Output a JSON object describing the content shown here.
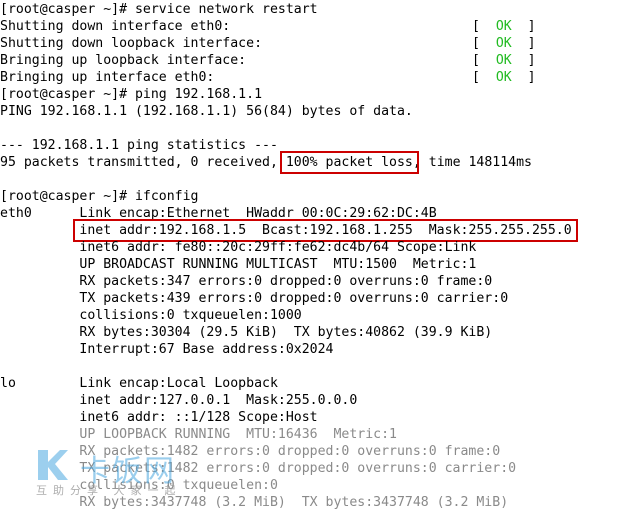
{
  "terminal": {
    "lines": [
      {
        "text": "[root@casper ~]# service network restart"
      },
      {
        "text": "Shutting down interface eth0:",
        "status": "OK"
      },
      {
        "text": "Shutting down loopback interface:",
        "status": "OK"
      },
      {
        "text": "Bringing up loopback interface:",
        "status": "OK"
      },
      {
        "text": "Bringing up interface eth0:",
        "status": "OK"
      },
      {
        "text": "[root@casper ~]# ping 192.168.1.1"
      },
      {
        "text": "PING 192.168.1.1 (192.168.1.1) 56(84) bytes of data."
      },
      {
        "text": ""
      },
      {
        "text": "--- 192.168.1.1 ping statistics ---"
      },
      {
        "pre": "95 packets transmitted, 0 received, ",
        "highlight": "100% packet loss",
        "post": ", time 148114ms"
      },
      {
        "text": ""
      },
      {
        "text": "[root@casper ~]# ifconfig"
      },
      {
        "text": "eth0      Link encap:Ethernet  HWaddr 00:0C:29:62:DC:4B"
      },
      {
        "pre": "          ",
        "highlight": "inet addr:192.168.1.5  Bcast:192.168.1.255  Mask:255.255.255.0",
        "post": ""
      },
      {
        "text": "          inet6 addr: fe80::20c:29ff:fe62:dc4b/64 Scope:Link"
      },
      {
        "text": "          UP BROADCAST RUNNING MULTICAST  MTU:1500  Metric:1"
      },
      {
        "text": "          RX packets:347 errors:0 dropped:0 overruns:0 frame:0"
      },
      {
        "text": "          TX packets:439 errors:0 dropped:0 overruns:0 carrier:0"
      },
      {
        "text": "          collisions:0 txqueuelen:1000"
      },
      {
        "text": "          RX bytes:30304 (29.5 KiB)  TX bytes:40862 (39.9 KiB)"
      },
      {
        "text": "          Interrupt:67 Base address:0x2024"
      },
      {
        "text": ""
      },
      {
        "text": "lo        Link encap:Local Loopback"
      },
      {
        "text": "          inet addr:127.0.0.1  Mask:255.0.0.0"
      },
      {
        "text": "          inet6 addr: ::1/128 Scope:Host"
      },
      {
        "text": "          UP LOOPBACK RUNNING  MTU:16436  Metric:1"
      },
      {
        "text": "          RX packets:1482 errors:0 dropped:0 overruns:0 frame:0"
      },
      {
        "text": "          TX packets:1482 errors:0 dropped:0 overruns:0 carrier:0"
      },
      {
        "text": "          collisions:0 txqueuelen:0"
      },
      {
        "text": "          RX bytes:3437748 (3.2 MiB)  TX bytes:3437748 (3.2 MiB)"
      }
    ]
  },
  "watermark": {
    "title": "卡饭网",
    "subtitle": "互助分享 大家一起"
  },
  "colors": {
    "ok": "#22bb22",
    "highlight_border": "#cc0000"
  }
}
